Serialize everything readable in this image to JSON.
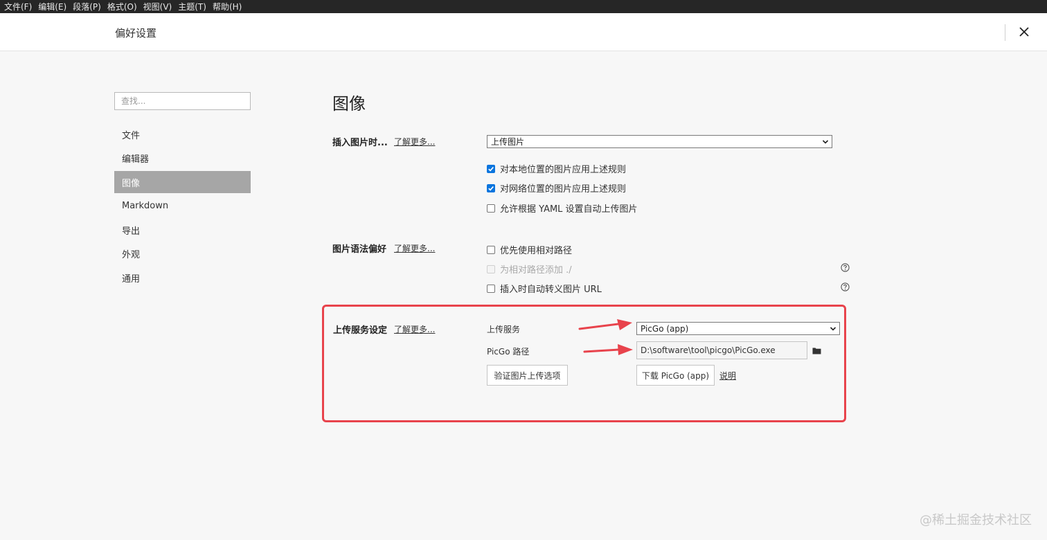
{
  "menubar": {
    "items": [
      "文件(F)",
      "编辑(E)",
      "段落(P)",
      "格式(O)",
      "视图(V)",
      "主题(T)",
      "帮助(H)"
    ]
  },
  "window": {
    "title": "偏好设置"
  },
  "sidebar": {
    "search_placeholder": "查找...",
    "items": [
      {
        "label": "文件"
      },
      {
        "label": "编辑器"
      },
      {
        "label": "图像",
        "active": true
      },
      {
        "label": "Markdown"
      },
      {
        "label": "导出"
      },
      {
        "label": "外观"
      },
      {
        "label": "通用"
      }
    ]
  },
  "main": {
    "title": "图像",
    "insert": {
      "label": "插入图片时...",
      "learn_more": "了解更多...",
      "select_value": "上传图片",
      "options": [
        {
          "label": "对本地位置的图片应用上述规则",
          "checked": true
        },
        {
          "label": "对网络位置的图片应用上述规则",
          "checked": true
        },
        {
          "label": "允许根据 YAML 设置自动上传图片",
          "checked": false
        }
      ]
    },
    "syntax": {
      "label": "图片语法偏好",
      "learn_more": "了解更多...",
      "options": [
        {
          "label": "优先使用相对路径",
          "checked": false,
          "disabled": false
        },
        {
          "label": "为相对路径添加 ./",
          "checked": false,
          "disabled": true
        },
        {
          "label": "插入时自动转义图片 URL",
          "checked": false,
          "disabled": false
        }
      ]
    },
    "upload": {
      "label": "上传服务设定",
      "learn_more": "了解更多...",
      "service_label": "上传服务",
      "service_value": "PicGo (app)",
      "path_label": "PicGo 路径",
      "path_value": "D:\\software\\tool\\picgo\\PicGo.exe",
      "verify_button": "验证图片上传选项",
      "download_button": "下载 PicGo (app)",
      "help_link": "说明"
    }
  },
  "watermark": "@稀土掘金技术社区",
  "colors": {
    "menubar_bg": "#262626",
    "active_nav_bg": "#a6a6a6",
    "checkbox_blue": "#0b75de",
    "highlight_red": "#e8434c"
  }
}
